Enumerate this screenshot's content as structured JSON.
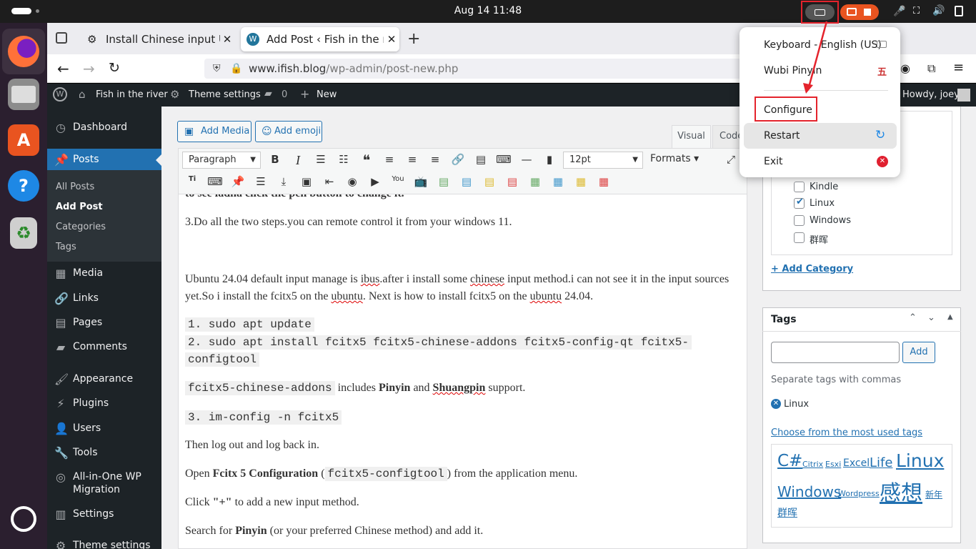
{
  "topbar": {
    "clock": "Aug 14  11:48"
  },
  "dock": {
    "apps": [
      "Firefox",
      "Files",
      "App Center",
      "Help",
      "Trash",
      "Ubuntu"
    ]
  },
  "browser": {
    "tabs": [
      {
        "title": "Install Chinese input Ubuntu",
        "active": false
      },
      {
        "title": "Add Post ‹ Fish in the river",
        "active": true
      }
    ],
    "new_tab": "+",
    "url_host": "www.ifish.blog",
    "url_path": "/wp-admin/post-new.php"
  },
  "adminbar": {
    "site": "Fish in the river",
    "theme": "Theme settings",
    "comments": "0",
    "new": "New",
    "howdy": "Howdy, joey"
  },
  "sidebar": {
    "items": [
      {
        "label": "Dashboard",
        "icon": "dashboard-icon"
      },
      {
        "label": "Posts",
        "icon": "pin-icon"
      },
      {
        "label": "Media",
        "icon": "media-icon"
      },
      {
        "label": "Links",
        "icon": "link-icon"
      },
      {
        "label": "Pages",
        "icon": "page-icon"
      },
      {
        "label": "Comments",
        "icon": "comment-icon"
      },
      {
        "label": "Appearance",
        "icon": "brush-icon"
      },
      {
        "label": "Plugins",
        "icon": "plugin-icon"
      },
      {
        "label": "Users",
        "icon": "user-icon"
      },
      {
        "label": "Tools",
        "icon": "wrench-icon"
      },
      {
        "label": "All-in-One WP",
        "label2": "Migration",
        "icon": "migration-icon"
      },
      {
        "label": "Settings",
        "icon": "settings-icon"
      },
      {
        "label": "Theme settings",
        "icon": "gear-icon"
      }
    ],
    "sub": [
      "All Posts",
      "Add Post",
      "Categories",
      "Tags"
    ]
  },
  "editor": {
    "add_media": "Add Media",
    "add_emoji": "Add emoji",
    "tab_visual": "Visual",
    "tab_code": "Code",
    "format_select": "Paragraph",
    "size_select": "12pt",
    "formats": "Formats",
    "cut_line": "to see ladna click the pen button to change it.",
    "p1": "3.Do all the two steps.you can remote control it from your windows 11.",
    "p2a": "Ubuntu 24.04 default input manage is ",
    "p2b": "ibus",
    ".p2c": "",
    "p2d": "after i install some ",
    "p2e": "chinese",
    " p2f": "",
    "p2_line1": [
      "Ubuntu 24.04 default input manage is ",
      "ibus",
      ".after i install some ",
      "chinese",
      " input method.i can not see it in the input sources"
    ],
    "p2_line2": [
      "yet.So i install the fcitx5 on the ",
      "ubuntu",
      ". Next is how to install fcitx5 on the ",
      "ubuntu",
      " 24.04."
    ],
    "code1": "1. sudo apt update",
    "code2": "2. sudo apt install fcitx5 fcitx5-chinese-addons fcitx5-config-qt fcitx5-",
    "code3": "configtool",
    "p3_code": "fcitx5-chinese-addons",
    "p3_mid": " includes ",
    "p3_b1": "Pinyin",
    "p3_and": " and ",
    "p3_b2": "Shuangpin",
    "p3_end": " support.",
    "code4": "3. im-config -n fcitx5",
    "p4": "Then log out and log back in.",
    "p5a": "Open ",
    "p5b": "Fcitx 5 Configuration",
    " p5c": "",
    "p5_open": " (",
    "p5_code": "fcitx5-configtool",
    "p5_end": ") from the application menu.",
    "p6a": "Click ",
    "p6b": "\"+\"",
    "p6c": " to add a new input method.",
    "p7a": "Search for ",
    "p7b": "Pinyin",
    "p7c": " (or your preferred Chinese method) and add it."
  },
  "categories": {
    "items": [
      {
        "label": "Kindle",
        "checked": false
      },
      {
        "label": "Linux",
        "checked": true
      },
      {
        "label": "Windows",
        "checked": false
      },
      {
        "label": "群晖",
        "checked": false
      }
    ],
    "add": "+ Add Category"
  },
  "tags": {
    "title": "Tags",
    "add": "Add",
    "hint": "Separate tags with commas",
    "current": "Linux",
    "choose": "Choose from the most used tags",
    "cloud": [
      "C#",
      "Citrix",
      "Esxi",
      "Excel",
      "Life",
      "Linux",
      "Windows",
      "Wordpress",
      "感想",
      "新年",
      "群晖"
    ]
  },
  "popup": {
    "items": [
      "Keyboard - English (US)",
      "Wubi Pinyin",
      "Configure",
      "Restart",
      "Exit"
    ]
  }
}
